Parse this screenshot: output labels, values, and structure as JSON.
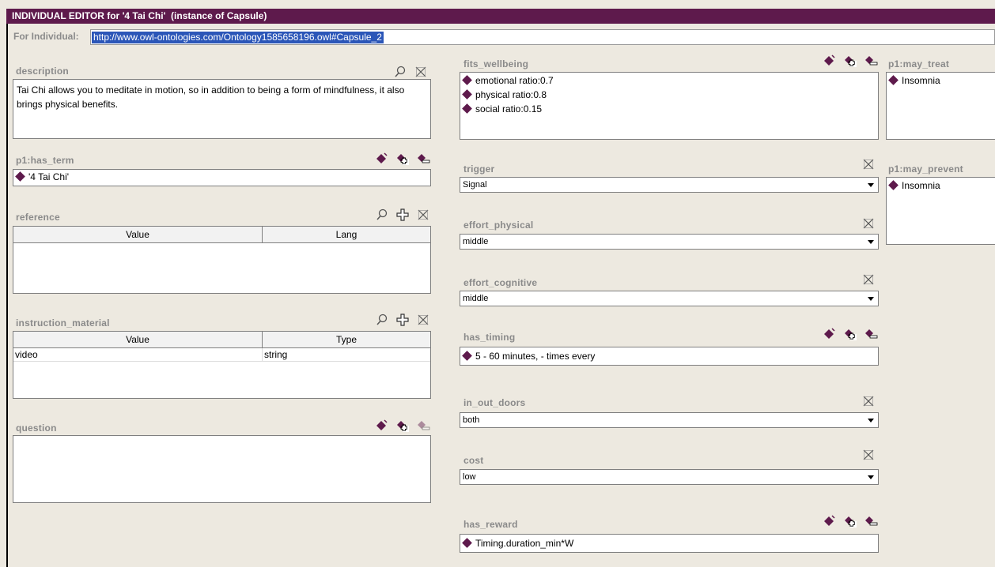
{
  "window": {
    "title": "INDIVIDUAL EDITOR for '4 Tai Chi'  (instance of Capsule)",
    "for_label": "For Individual:",
    "url": "http://www.owl-ontologies.com/Ontology1585658196.owl#Capsule_2"
  },
  "description": {
    "label": "description",
    "text": "Tai Chi allows you to meditate in motion, so in addition to being a form of mindfulness, it also brings physical benefits."
  },
  "has_term": {
    "label": "p1:has_term",
    "items": [
      "'4 Tai Chi'"
    ]
  },
  "reference": {
    "label": "reference",
    "columns": [
      "Value",
      "Lang"
    ],
    "rows": []
  },
  "instruction_material": {
    "label": "instruction_material",
    "columns": [
      "Value",
      "Type"
    ],
    "rows": [
      [
        "video",
        "string"
      ]
    ]
  },
  "question": {
    "label": "question",
    "items": []
  },
  "fits_wellbeing": {
    "label": "fits_wellbeing",
    "items": [
      "emotional ratio:0.7",
      "physical ratio:0.8",
      "social ratio:0.15"
    ]
  },
  "trigger": {
    "label": "trigger",
    "value": "Signal"
  },
  "effort_physical": {
    "label": "effort_physical",
    "value": "middle"
  },
  "effort_cognitive": {
    "label": "effort_cognitive",
    "value": "middle"
  },
  "has_timing": {
    "label": "has_timing",
    "items": [
      "5 - 60 minutes,  -  times every"
    ]
  },
  "in_out_doors": {
    "label": "in_out_doors",
    "value": "both"
  },
  "cost": {
    "label": "cost",
    "value": "low"
  },
  "has_reward": {
    "label": "has_reward",
    "items": [
      "Timing.duration_min*W"
    ]
  },
  "may_treat": {
    "label": "p1:may_treat",
    "items": [
      "Insomnia"
    ]
  },
  "may_prevent": {
    "label": "p1:may_prevent",
    "items": [
      "Insomnia"
    ]
  },
  "colors": {
    "titlebar": "#5e1a4c",
    "background": "#ede9e0",
    "label_gray": "#8a8a8a",
    "selection": "#2b56b8"
  }
}
